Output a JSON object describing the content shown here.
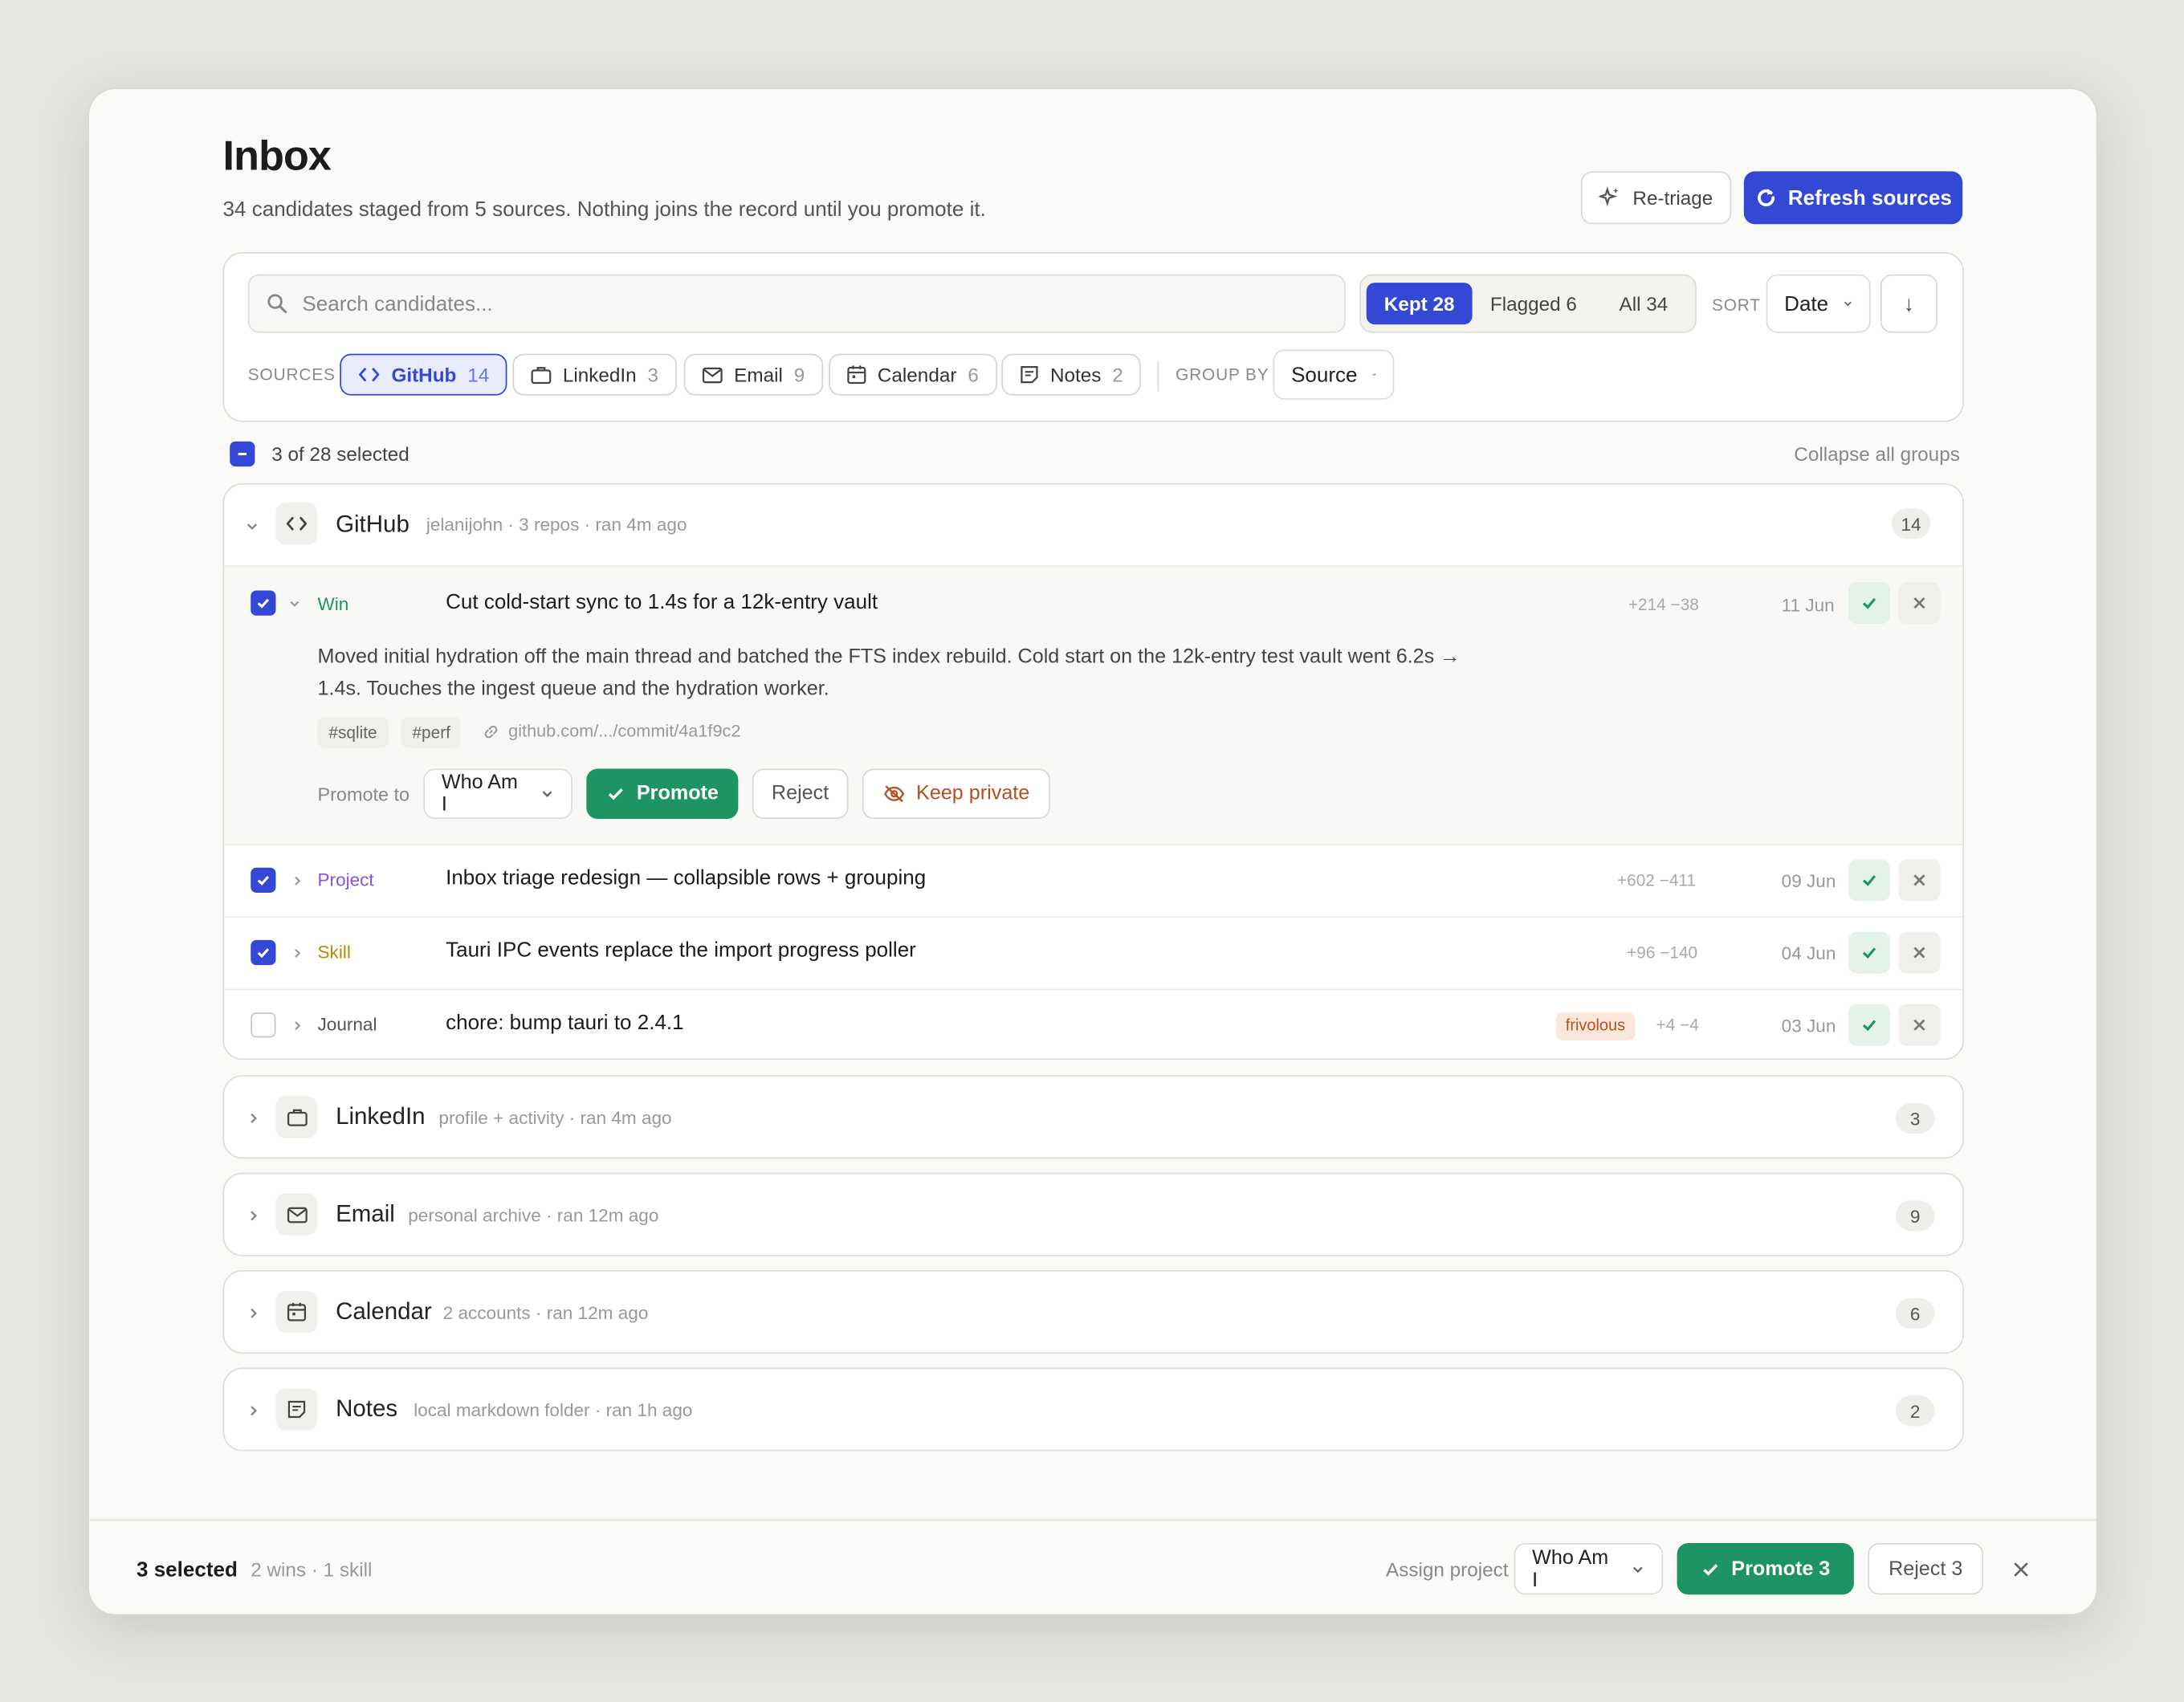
{
  "header": {
    "title": "Inbox",
    "subtitle": "34 candidates staged from 5 sources. Nothing joins the record until you promote it.",
    "retriage_label": "Re-triage",
    "refresh_label": "Refresh sources"
  },
  "toolbar": {
    "search_placeholder": "Search candidates...",
    "filters": [
      {
        "label": "Kept 28",
        "active": true
      },
      {
        "label": "Flagged 6",
        "active": false
      },
      {
        "label": "All 34",
        "active": false
      }
    ],
    "sort_label": "SORT",
    "sort_value": "Date",
    "sort_direction": "↓",
    "sources_label": "SOURCES",
    "sources": [
      {
        "name": "GitHub",
        "count": "14",
        "icon": "code-icon",
        "active": true
      },
      {
        "name": "LinkedIn",
        "count": "3",
        "icon": "briefcase-icon",
        "active": false
      },
      {
        "name": "Email",
        "count": "9",
        "icon": "mail-icon",
        "active": false
      },
      {
        "name": "Calendar",
        "count": "6",
        "icon": "calendar-icon",
        "active": false
      },
      {
        "name": "Notes",
        "count": "2",
        "icon": "note-icon",
        "active": false
      }
    ],
    "group_by_label": "GROUP BY",
    "group_by_value": "Source"
  },
  "selection": {
    "summary": "3 of 28 selected",
    "collapse_label": "Collapse all groups"
  },
  "github_group": {
    "name": "GitHub",
    "meta": "jelanijohn · 3 repos · ran 4m ago",
    "count": "14",
    "expanded_item": {
      "kind": "Win",
      "title": "Cut cold-start sync to 1.4s for a 12k-entry vault",
      "diff": "+214 −38",
      "date": "11 Jun",
      "description_line1": "Moved initial hydration off the main thread and batched the FTS index rebuild. Cold start on the 12k-entry test vault went 6.2s →",
      "description_line2": "1.4s. Touches the ingest queue and the hydration worker.",
      "tags": [
        "#sqlite",
        "#perf"
      ],
      "link": "github.com/.../commit/4a1f9c2",
      "promote_to_label": "Promote to",
      "promote_to_value": "Who Am I",
      "promote_label": "Promote",
      "reject_label": "Reject",
      "keep_private_label": "Keep private"
    },
    "rows": [
      {
        "kind": "Project",
        "title": "Inbox triage redesign — collapsible rows + grouping",
        "diff": "+602 −411",
        "date": "09 Jun",
        "badge": ""
      },
      {
        "kind": "Skill",
        "title": "Tauri IPC events replace the import progress poller",
        "diff": "+96 −140",
        "date": "04 Jun",
        "badge": ""
      },
      {
        "kind": "Journal",
        "title": "chore: bump tauri to 2.4.1",
        "diff": "+4 −4",
        "date": "03 Jun",
        "badge": "frivolous"
      }
    ]
  },
  "groups": [
    {
      "name": "LinkedIn",
      "meta": "profile + activity · ran 4m ago",
      "count": "3",
      "icon": "briefcase-icon"
    },
    {
      "name": "Email",
      "meta": "personal archive · ran 12m ago",
      "count": "9",
      "icon": "mail-icon"
    },
    {
      "name": "Calendar",
      "meta": "2 accounts · ran 12m ago",
      "count": "6",
      "icon": "calendar-icon"
    },
    {
      "name": "Notes",
      "meta": "local markdown folder · ran 1h ago",
      "count": "2",
      "icon": "note-icon"
    }
  ],
  "bulk_bar": {
    "selected": "3 selected",
    "detail": "2 wins · 1 skill",
    "assign_label": "Assign project",
    "assign_value": "Who Am I",
    "promote_label": "Promote 3",
    "reject_label": "Reject 3"
  },
  "colors": {
    "accent": "#3448d6",
    "success": "#1f9463",
    "win": "#1f9463",
    "project": "#8b4fd8",
    "skill": "#b88a00",
    "journal": "#555555",
    "warning": "#b4501f"
  }
}
